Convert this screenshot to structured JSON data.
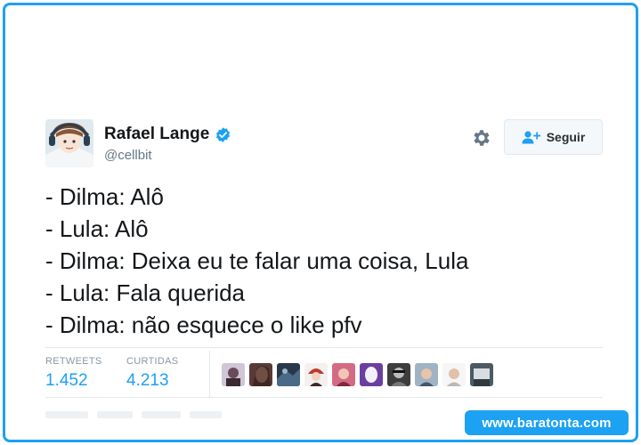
{
  "tweet": {
    "author": {
      "display_name": "Rafael Lange",
      "handle": "@cellbit",
      "verified": true
    },
    "follow_button": {
      "label": "Seguir",
      "icon": "add-user-icon"
    },
    "settings_icon": "gear-icon",
    "lines": [
      "- Dilma: Alô",
      "- Lula: Alô",
      "- Dilma: Deixa eu te falar uma coisa, Lula",
      "- Lula: Fala querida",
      "- Dilma: não esquece o like pfv"
    ],
    "stats": {
      "retweets_label": "RETWEETS",
      "retweets_value": "1.452",
      "likes_label": "CURTIDAS",
      "likes_value": "4.213"
    },
    "liker_avatar_count": 10
  },
  "watermark": {
    "text": "www.baratonta.com"
  },
  "colors": {
    "accent": "#1da1f2",
    "text": "#14171a",
    "muted": "#657786",
    "border": "#e1e8ed"
  }
}
